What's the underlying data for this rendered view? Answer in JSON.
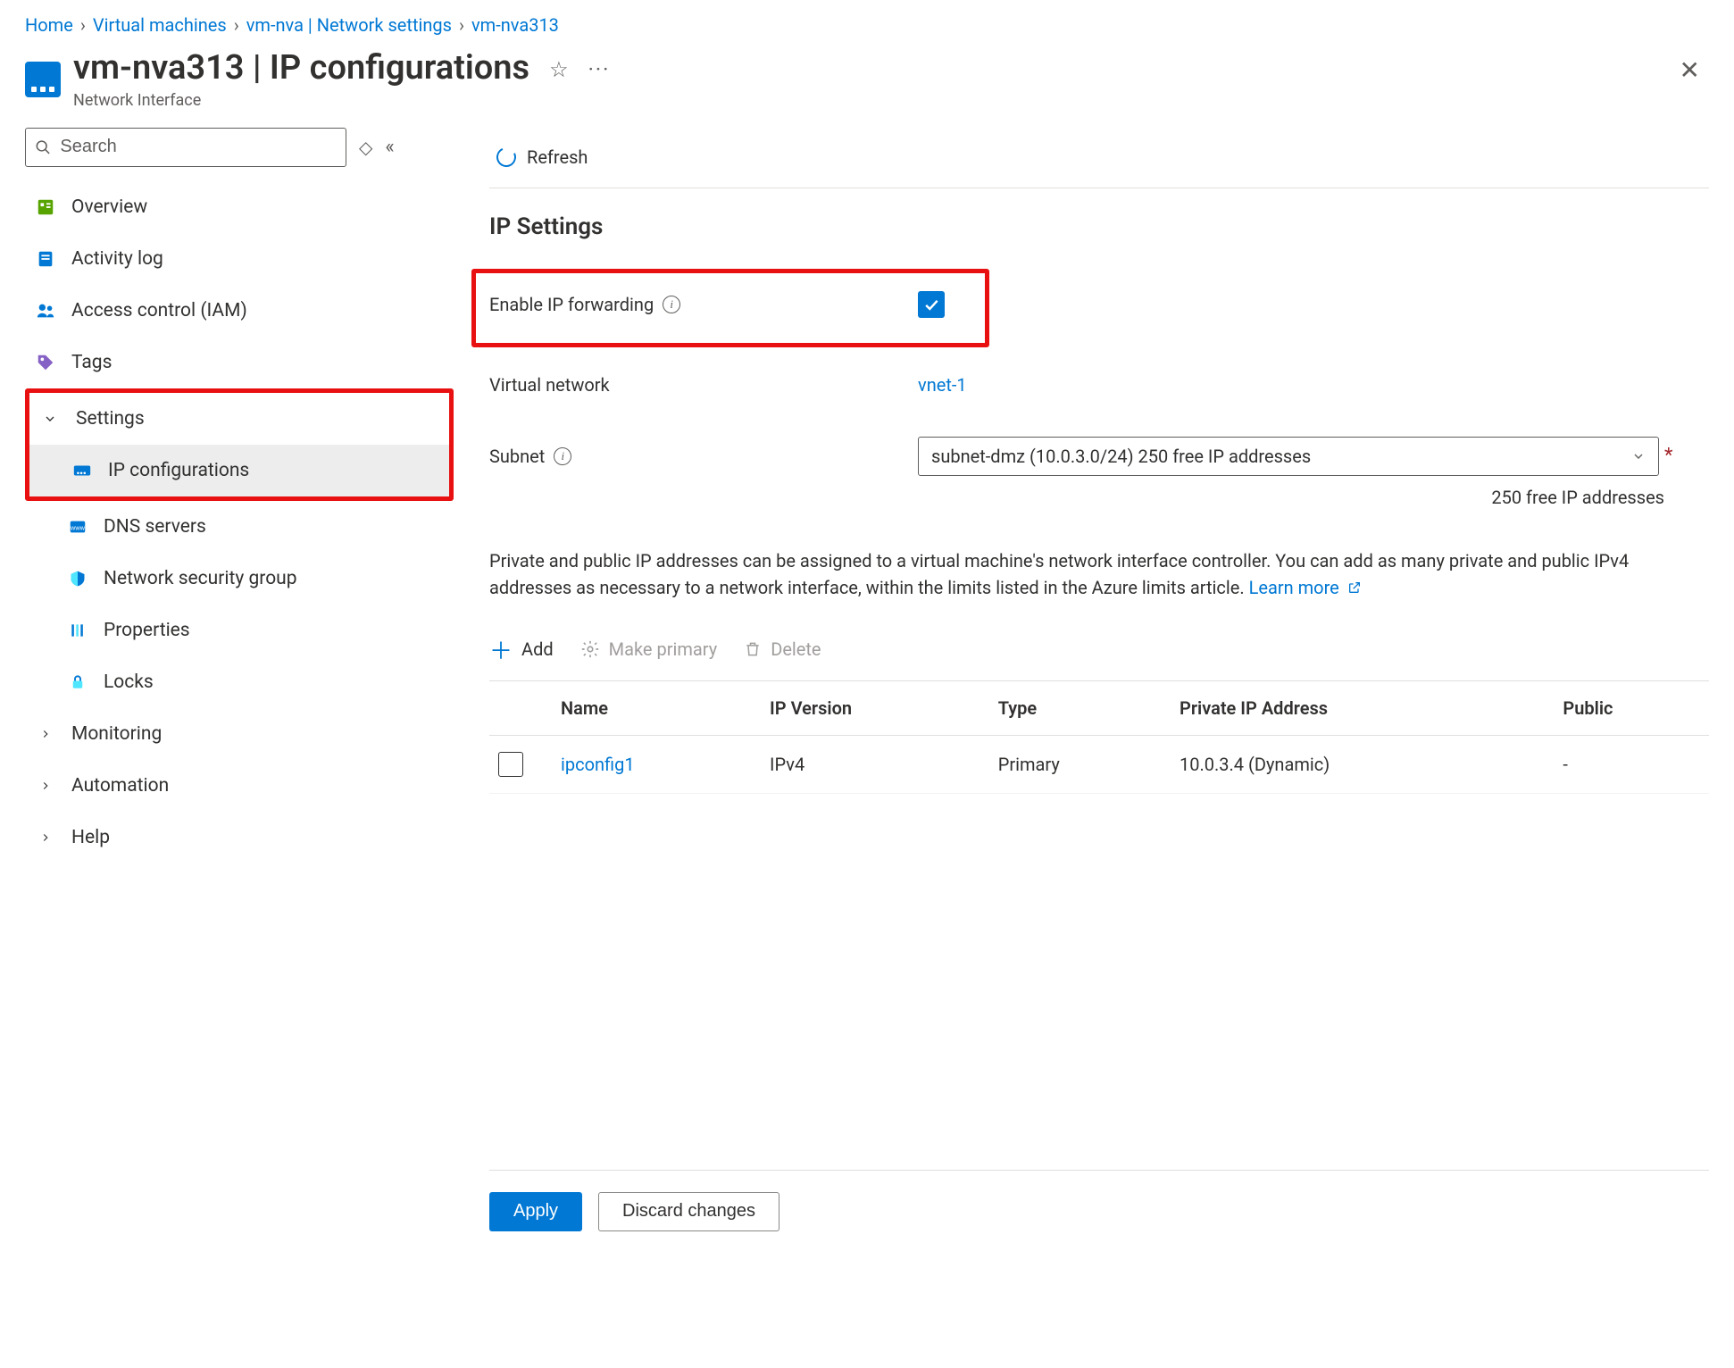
{
  "breadcrumb": {
    "items": [
      "Home",
      "Virtual machines",
      "vm-nva | Network settings",
      "vm-nva313"
    ]
  },
  "header": {
    "title": "vm-nva313 | IP configurations",
    "subtitle": "Network Interface"
  },
  "search": {
    "placeholder": "Search"
  },
  "nav": {
    "overview": "Overview",
    "activity": "Activity log",
    "iam": "Access control (IAM)",
    "tags": "Tags",
    "settings": "Settings",
    "ipconfig": "IP configurations",
    "dns": "DNS servers",
    "nsg": "Network security group",
    "props": "Properties",
    "locks": "Locks",
    "monitoring": "Monitoring",
    "automation": "Automation",
    "help": "Help"
  },
  "toolbar": {
    "refresh": "Refresh"
  },
  "ipSettings": {
    "heading": "IP Settings",
    "forwarding_label": "Enable IP forwarding",
    "vnet_label": "Virtual network",
    "vnet_value": "vnet-1",
    "subnet_label": "Subnet",
    "subnet_value": "subnet-dmz (10.0.3.0/24) 250 free IP addresses",
    "subnet_helper": "250 free IP addresses",
    "description": "Private and public IP addresses can be assigned to a virtual machine's network interface controller. You can add as many private and public IPv4 addresses as necessary to a network interface, within the limits listed in the Azure limits article.  ",
    "learn_more": "Learn more"
  },
  "listToolbar": {
    "add": "Add",
    "make_primary": "Make primary",
    "delete": "Delete"
  },
  "table": {
    "cols": {
      "name": "Name",
      "ipversion": "IP Version",
      "type": "Type",
      "private": "Private IP Address",
      "public": "Public"
    },
    "rows": [
      {
        "name": "ipconfig1",
        "ipversion": "IPv4",
        "type": "Primary",
        "private": "10.0.3.4 (Dynamic)",
        "public": "-"
      }
    ]
  },
  "footer": {
    "apply": "Apply",
    "discard": "Discard changes"
  }
}
